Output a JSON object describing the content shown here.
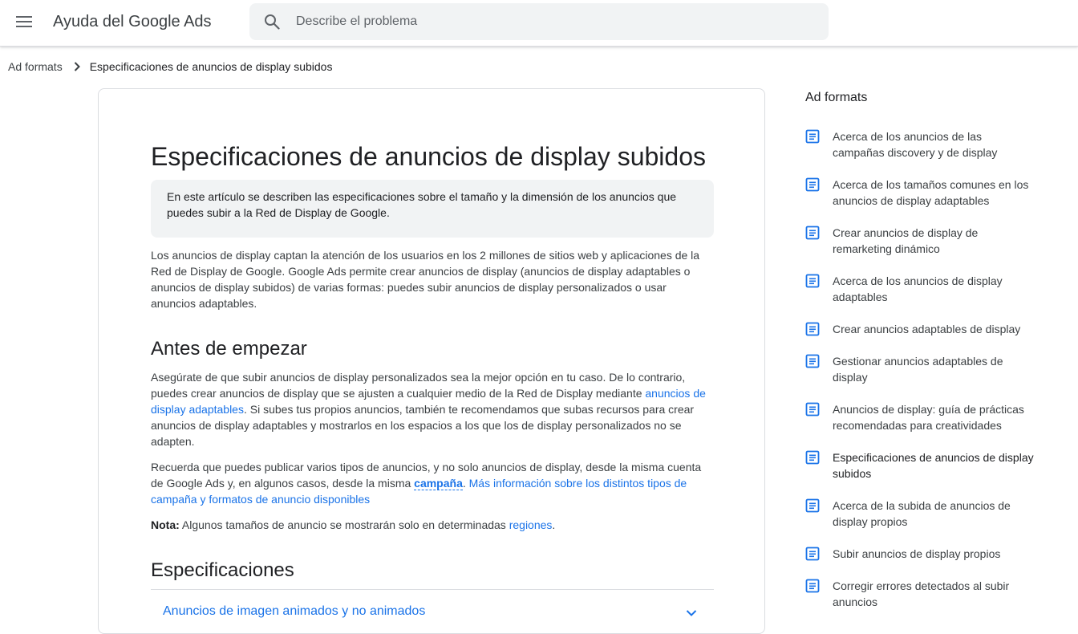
{
  "header": {
    "app_title": "Ayuda del Google Ads",
    "search_placeholder": "Describe el problema"
  },
  "breadcrumb": {
    "parent": "Ad formats",
    "current": "Especificaciones de anuncios de display subidos"
  },
  "article": {
    "title": "Especificaciones de anuncios de display subidos",
    "summary": "En este artículo se describen las especificaciones sobre el tamaño y la dimensión de los anuncios que puedes subir a la Red de Display de Google.",
    "intro": "Los anuncios de display captan la atención de los usuarios en los 2 millones de sitios web y aplicaciones de la Red de Display de Google. Google Ads permite crear anuncios de display (anuncios de display adaptables o anuncios de display subidos) de varias formas: puedes subir anuncios de display personalizados o usar anuncios adaptables.",
    "section1_heading": "Antes de empezar",
    "p1_text_a": "Asegúrate de que subir anuncios de display personalizados sea la mejor opción en tu caso. De lo contrario, puedes crear anuncios de display que se ajusten a cualquier medio de la Red de Display mediante ",
    "p1_link": "anuncios de display adaptables",
    "p1_text_b": ". Si subes tus propios anuncios, también te recomendamos que subas recursos para crear anuncios de display adaptables y mostrarlos en los espacios a los que los de display personalizados no se adapten.",
    "p2_text_a": "Recuerda que puedes publicar varios tipos de anuncios, y no solo anuncios de display, desde la misma cuenta de Google Ads y, en algunos casos, desde la misma ",
    "p2_glossary": "campaña",
    "p2_text_b": ". ",
    "p2_link": "Más información sobre los distintos tipos de campaña y formatos de anuncio disponibles",
    "note_label": "Nota:",
    "note_text": " Algunos tamaños de anuncio se mostrarán solo en determinadas ",
    "note_link": "regiones",
    "note_end": ".",
    "section2_heading": "Especificaciones",
    "accordion_title": "Anuncios de imagen animados y no animados"
  },
  "sidebar": {
    "title": "Ad formats",
    "items": [
      {
        "label": "Acerca de los anuncios de las campañas discovery y de display",
        "active": false
      },
      {
        "label": "Acerca de los tamaños comunes en los anuncios de display adaptables",
        "active": false
      },
      {
        "label": "Crear anuncios de display de remarketing dinámico",
        "active": false
      },
      {
        "label": "Acerca de los anuncios de display adaptables",
        "active": false
      },
      {
        "label": "Crear anuncios adaptables de display",
        "active": false
      },
      {
        "label": "Gestionar anuncios adaptables de display",
        "active": false
      },
      {
        "label": "Anuncios de display: guía de prácticas recomendadas para creatividades",
        "active": false
      },
      {
        "label": "Especificaciones de anuncios de display subidos",
        "active": true
      },
      {
        "label": "Acerca de la subida de anuncios de display propios",
        "active": false
      },
      {
        "label": "Subir anuncios de display propios",
        "active": false
      },
      {
        "label": "Corregir errores detectados al subir anuncios",
        "active": false
      }
    ]
  },
  "colors": {
    "link": "#1a73e8",
    "icon_blue": "#1a73e8",
    "summary_bg": "#f1f3f4",
    "search_bg": "#f1f3f4"
  },
  "icons": {
    "menu": "menu-icon",
    "search": "search-icon",
    "breadcrumb_separator": "chevron-right-icon",
    "accordion": "chevron-down-icon",
    "sidebar_item": "article-icon"
  }
}
